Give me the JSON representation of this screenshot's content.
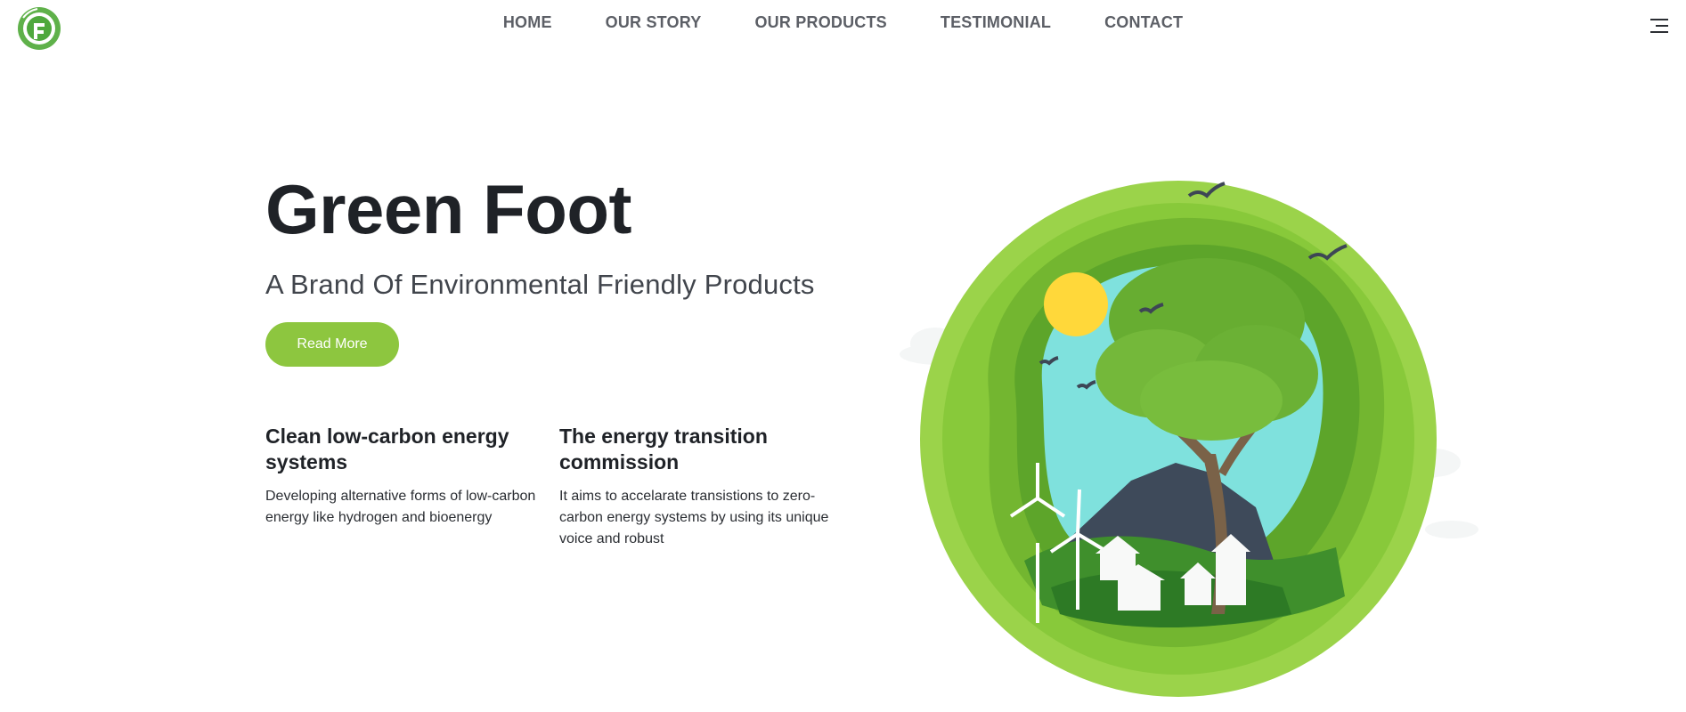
{
  "header": {
    "logo_icon": "green-foot-logo-icon",
    "nav": [
      {
        "label": "HOME"
      },
      {
        "label": "OUR STORY"
      },
      {
        "label": "OUR PRODUCTS"
      },
      {
        "label": "TESTIMONIAL"
      },
      {
        "label": "CONTACT"
      }
    ],
    "menu_icon": "hamburger-menu-icon"
  },
  "hero": {
    "title": "Green Foot",
    "subtitle": "A Brand Of Environmental Friendly Products",
    "cta_label": "Read More"
  },
  "features": [
    {
      "title": "Clean low-carbon energy systems",
      "body": "Developing alternative forms of low-carbon energy like hydrogen and bioenergy"
    },
    {
      "title": "The energy transition commission",
      "body": "It aims to accelarate transistions to zero-carbon energy systems by using its unique voice and robust"
    }
  ],
  "colors": {
    "accent": "#8dc63f",
    "title": "#1f2227",
    "nav": "#5c5f66"
  }
}
